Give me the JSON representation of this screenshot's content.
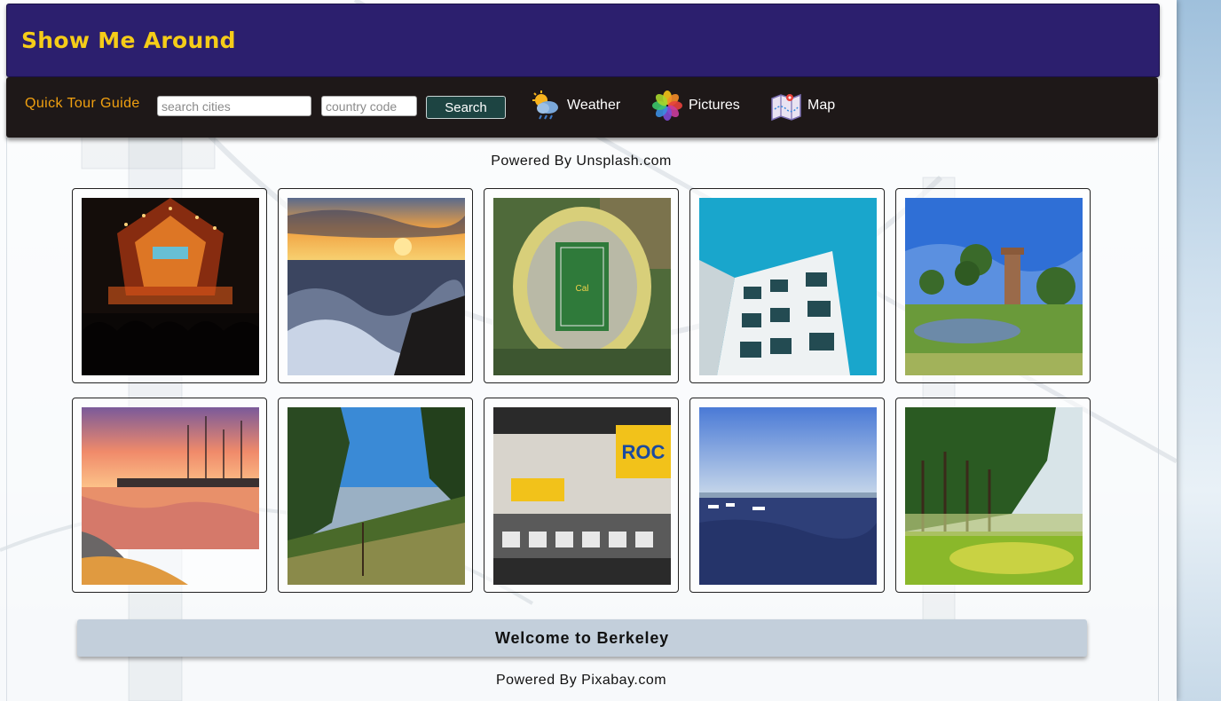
{
  "header": {
    "title": "Show Me Around"
  },
  "nav": {
    "brand": "Quick Tour Guide",
    "city_placeholder": "search cities",
    "country_placeholder": "country code",
    "search_label": "Search",
    "links": [
      {
        "label": "Weather",
        "icon": "weather-icon"
      },
      {
        "label": "Pictures",
        "icon": "pictures-icon"
      },
      {
        "label": "Map",
        "icon": "map-icon"
      }
    ]
  },
  "gallery": {
    "credit": "Powered By Unsplash.com",
    "photos": [
      {
        "subject": "concert-stage"
      },
      {
        "subject": "sunset-ocean-waves"
      },
      {
        "subject": "aerial-stadium"
      },
      {
        "subject": "white-building-blue-sky"
      },
      {
        "subject": "tower-by-pond"
      },
      {
        "subject": "marina-sunset"
      },
      {
        "subject": "hillside-city-view"
      },
      {
        "subject": "record-store-interior"
      },
      {
        "subject": "bay-with-boats"
      },
      {
        "subject": "trees-meadow"
      }
    ]
  },
  "welcome": {
    "text": "Welcome to Berkeley"
  },
  "footer": {
    "credit": "Powered By Pixabay.com"
  },
  "colors": {
    "header_bg": "#2c1f6e",
    "title": "#f5cc18",
    "navbar_bg": "#1e1818",
    "brand": "#f0a010",
    "search_button": "#1d4442",
    "welcome_bg": "#c3cfdb"
  }
}
